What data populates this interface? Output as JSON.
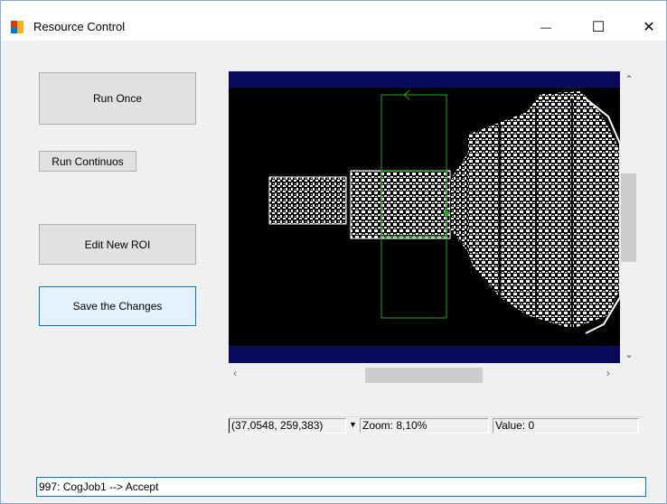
{
  "window": {
    "title": "Resource Control",
    "minimize_glyph": "—",
    "maximize_glyph": "☐",
    "close_glyph": "✕"
  },
  "buttons": {
    "run_once": "Run Once",
    "run_continuous": "Run Continuos",
    "edit_roi": "Edit New ROI",
    "save_changes": "Save the Changes"
  },
  "display": {
    "icon": "camera-image-display",
    "roi_color": "#1fa81f"
  },
  "status": {
    "coords": "(37,0548, 259,383)",
    "zoom": "Zoom: 8,10%",
    "value": "Value: 0"
  },
  "log": {
    "text": "997: CogJob1 --> Accept"
  }
}
